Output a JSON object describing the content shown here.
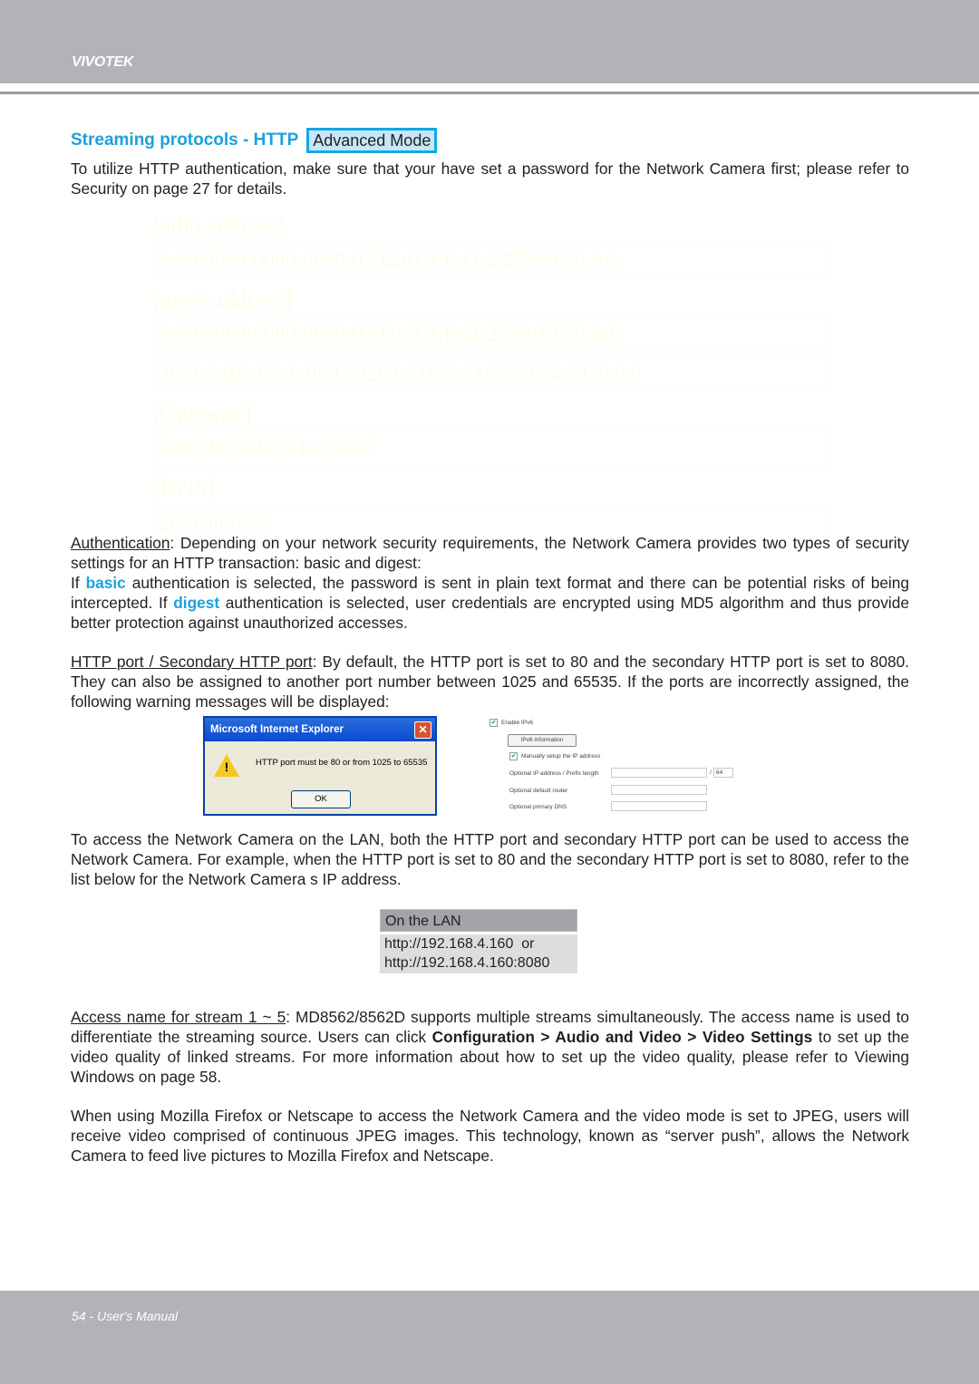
{
  "header": {
    "brand": "VIVOTEK"
  },
  "section": {
    "title": "Streaming protocols - HTTP",
    "badge": "Advanced Mode",
    "intro": "To utilize HTTP authentication, make sure that your have set a password for the Network Camera first; please refer to Security on page 27 for details."
  },
  "faded_panel": {
    "eth0_label": "[eth0 address]",
    "eth0_value": "fe80:0000:0000:0000:0202:d1ff:fe11:2299/64@Link",
    "ppp0_label": "[ppp0 address]",
    "ppp0_value1": "fe80:0000:0000:0000:0202:d1ff:fe11:2299/10@Link",
    "ppp0_value2": "2001:b100:01e0:0002:0202:d1ff:fe11:2299/64@Global",
    "gateway_label": "[Gateway]",
    "gateway_value": "fe80::90:1a00:4142:8ced",
    "dns_label": "[DNS]",
    "dns_value": "2001:b000::1"
  },
  "authentication": {
    "term": "Authentication",
    "text1": ": Depending on your network security requirements, the Network Camera provides two types of security settings for an HTTP transaction: basic and digest:",
    "text2a": "If ",
    "basic": "basic",
    "text2b": " authentication is selected, the password is sent in plain text format and there can be potential risks of being intercepted. If ",
    "digest": "digest",
    "text2c": " authentication is selected, user credentials are encrypted using MD5 algorithm and thus provide better protection against unauthorized accesses."
  },
  "http_port": {
    "term": "HTTP port / Secondary HTTP port",
    "text": ": By default, the HTTP port is set to 80 and the secondary HTTP port is set to 8080. They can also be assigned to another port number between 1025 and 65535. If the ports are incorrectly assigned, the following warning messages will be displayed:"
  },
  "ie_dialog": {
    "title": "Microsoft Internet Explorer",
    "message": "HTTP port must be 80 or from 1025 to 65535",
    "ok_label": "OK",
    "close_glyph": "✕",
    "warning_glyph": "!"
  },
  "ipv6_panel": {
    "enable_label": "Enable IPv6",
    "enable_checked": true,
    "info_button": "IPv6 information",
    "manual_label": "Manually setup the IP address",
    "manual_checked": true,
    "ip_label": "Optional IP address / Prefix length",
    "ip_value": "",
    "prefix_value": "64",
    "router_label": "Optional default router",
    "router_value": "",
    "dns_label": "Optional primary DNS",
    "dns_value": "",
    "check_glyph": "✔"
  },
  "lan_access": {
    "text": "To access the Network Camera on the LAN, both the HTTP port and secondary HTTP port can be used to access the Network Camera. For example, when the HTTP port is set to 80 and the secondary HTTP port is set to 8080, refer to the list below for the Network Camera s IP address.",
    "table_header": "On the LAN",
    "url1": "http://192.168.4.160  or",
    "url2": "http://192.168.4.160:8080"
  },
  "access_name": {
    "term": "Access name for stream 1 ~ 5",
    "text1": ": MD8562/8562D supports multiple streams simultaneously. The access name is used to differentiate the streaming source. Users can click ",
    "bold1": "Configuration > Audio and Video > Video Settings",
    "text2": " to set up the video quality of linked streams. For more information about how to set up the video quality, please refer to Viewing Windows on page 58."
  },
  "firefox_note": "When using Mozilla Firefox or Netscape to access the Network Camera and the video mode is set to JPEG, users will receive video comprised of continuous JPEG images. This technology, known as “server push”, allows the Network Camera to feed live pictures to Mozilla Firefox and Netscape.",
  "footer": {
    "page_label": "54 - User's Manual"
  }
}
